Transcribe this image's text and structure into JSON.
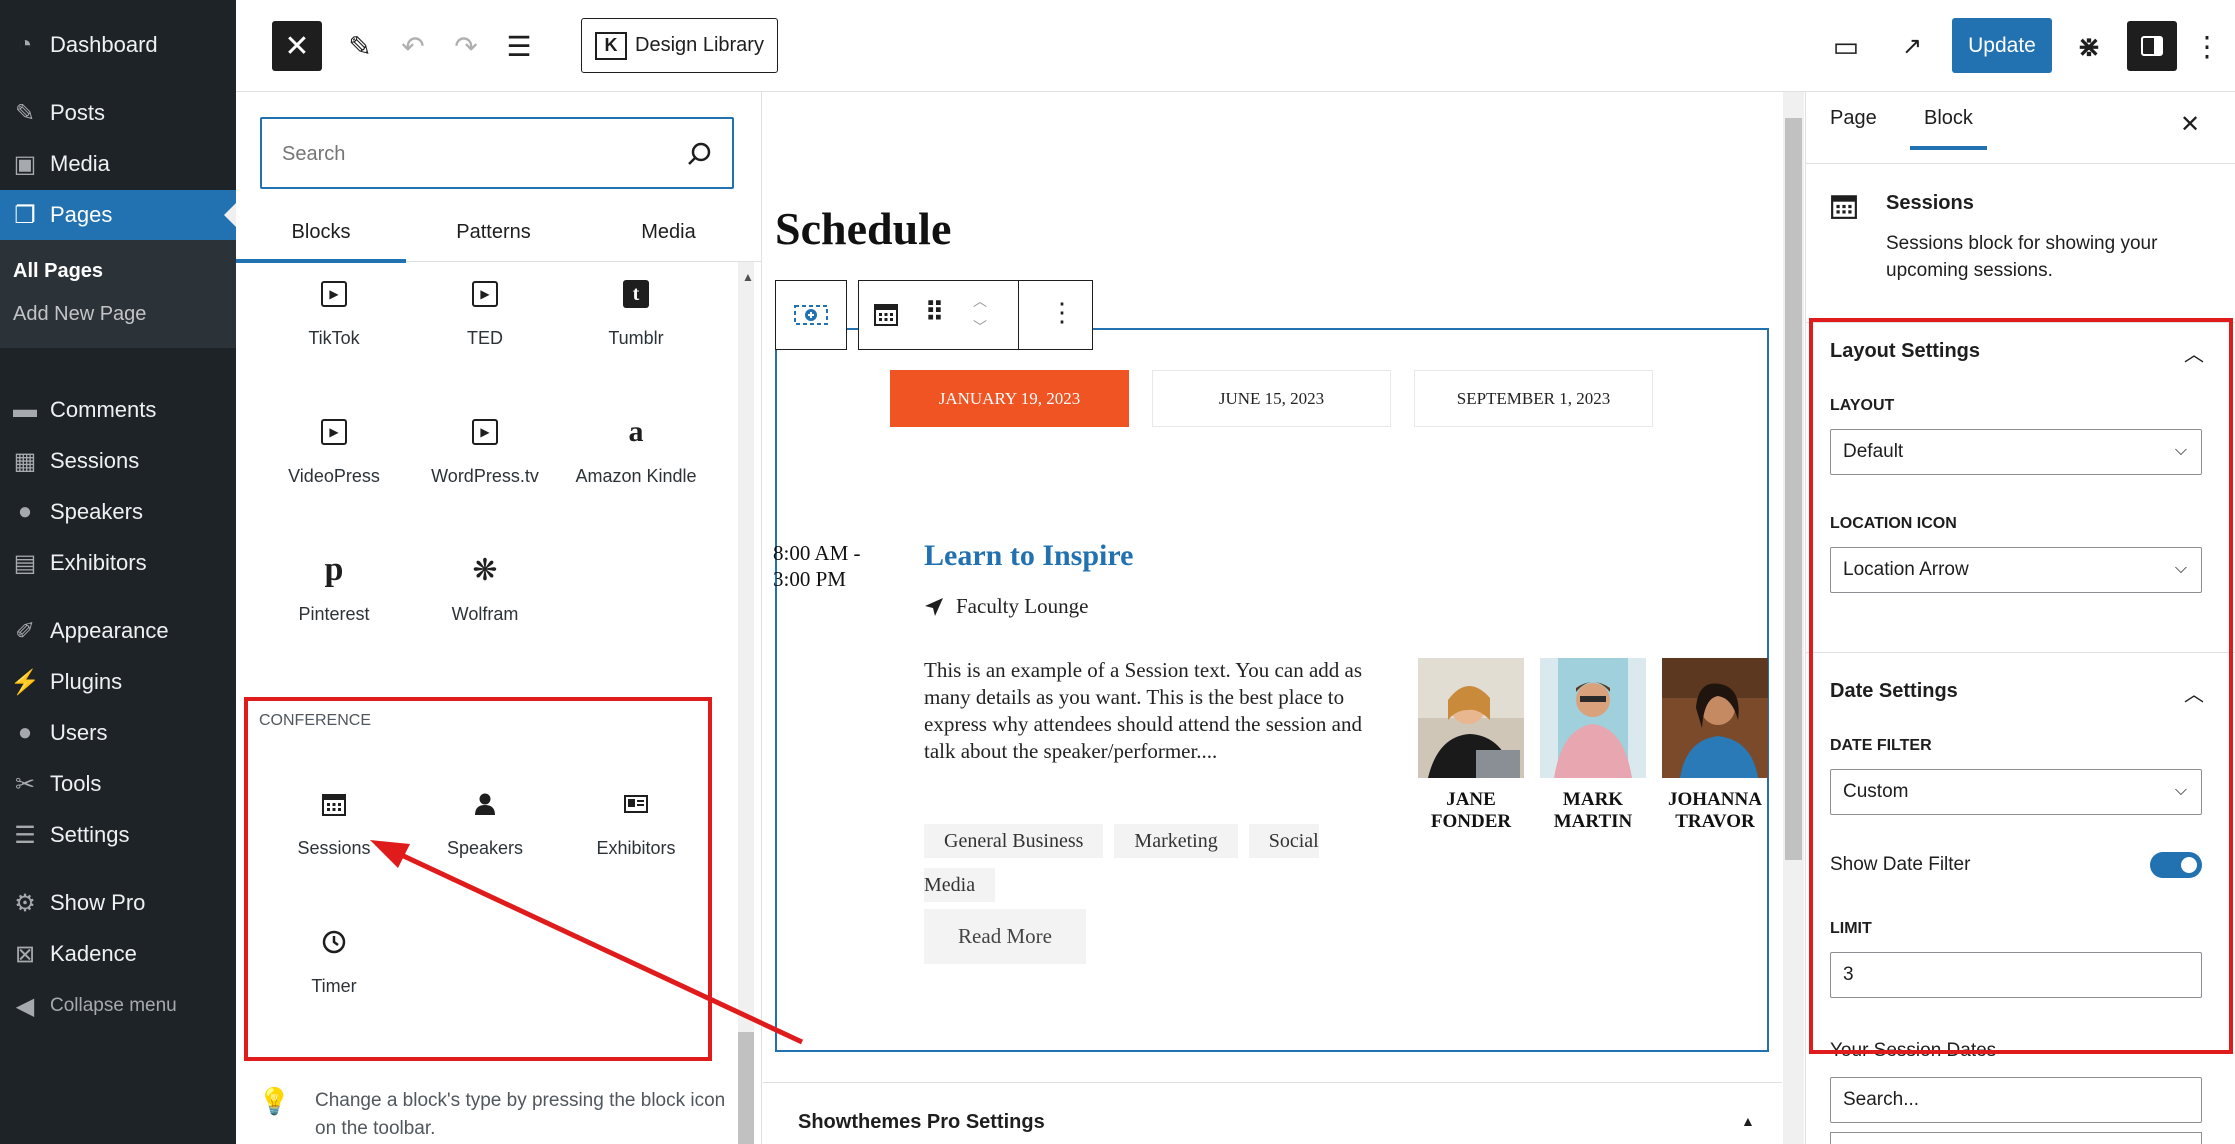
{
  "admin_menu": {
    "items": [
      {
        "label": "Dashboard",
        "icon": "dashboard-icon"
      },
      {
        "label": "Posts",
        "icon": "pin-icon"
      },
      {
        "label": "Media",
        "icon": "media-icon"
      },
      {
        "label": "Pages",
        "icon": "pages-icon"
      },
      {
        "label": "Comments",
        "icon": "comment-icon"
      },
      {
        "label": "Sessions",
        "icon": "calendar-icon"
      },
      {
        "label": "Speakers",
        "icon": "person-icon"
      },
      {
        "label": "Exhibitors",
        "icon": "id-card-icon"
      },
      {
        "label": "Appearance",
        "icon": "brush-icon"
      },
      {
        "label": "Plugins",
        "icon": "plug-icon"
      },
      {
        "label": "Users",
        "icon": "users-icon"
      },
      {
        "label": "Tools",
        "icon": "wrench-icon"
      },
      {
        "label": "Settings",
        "icon": "sliders-icon"
      },
      {
        "label": "Show Pro",
        "icon": "gear-icon"
      },
      {
        "label": "Kadence",
        "icon": "kadence-icon"
      }
    ],
    "submenu": [
      "All Pages",
      "Add New Page"
    ],
    "collapse_label": "Collapse menu"
  },
  "toolbar": {
    "design_library_label": "Design Library",
    "update_label": "Update"
  },
  "inserter": {
    "search_placeholder": "Search",
    "tabs": [
      "Blocks",
      "Patterns",
      "Media"
    ],
    "embed_blocks": [
      {
        "label": "TikTok",
        "icon": "tiktok-icon"
      },
      {
        "label": "TED",
        "icon": "ted-icon"
      },
      {
        "label": "Tumblr",
        "icon": "tumblr-icon"
      },
      {
        "label": "VideoPress",
        "icon": "videopress-icon"
      },
      {
        "label": "WordPress.tv",
        "icon": "wordpresstv-icon"
      },
      {
        "label": "Amazon Kindle",
        "icon": "amazon-icon"
      },
      {
        "label": "Pinterest",
        "icon": "pinterest-icon"
      },
      {
        "label": "Wolfram",
        "icon": "wolfram-icon"
      }
    ],
    "category_label": "CONFERENCE",
    "conference_blocks": [
      {
        "label": "Sessions",
        "icon": "calendar-icon"
      },
      {
        "label": "Speakers",
        "icon": "person-icon"
      },
      {
        "label": "Exhibitors",
        "icon": "id-card-icon"
      },
      {
        "label": "Timer",
        "icon": "clock-icon"
      }
    ],
    "tip": "Change a block's type by pressing the block icon on the toolbar."
  },
  "canvas": {
    "page_title": "Schedule",
    "date_tabs": [
      "JANUARY 19, 2023",
      "JUNE 15, 2023",
      "SEPTEMBER 1, 2023"
    ],
    "session": {
      "time_line1": "8:00 AM -",
      "time_line2": "3:00 PM",
      "title": "Learn to Inspire",
      "location": "Faculty Lounge",
      "description": "This is an example of a Session text. You can add as many details as you want. This is the best place to express why attendees should attend the session and talk about the speaker/performer....",
      "tags": [
        "General Business",
        "Marketing",
        "Social Media"
      ],
      "read_more": "Read More",
      "speakers": [
        {
          "line1": "JANE",
          "line2": "FONDER"
        },
        {
          "line1": "MARK",
          "line2": "MARTIN"
        },
        {
          "line1": "JOHANNA",
          "line2": "TRAVOR"
        }
      ]
    },
    "metabox_title": "Showthemes Pro Settings"
  },
  "settings": {
    "tabs": [
      "Page",
      "Block"
    ],
    "block_card": {
      "title": "Sessions",
      "description": "Sessions block for showing your upcoming sessions."
    },
    "layout_panel": {
      "title": "Layout Settings",
      "layout_label": "LAYOUT",
      "layout_value": "Default",
      "location_icon_label": "LOCATION ICON",
      "location_icon_value": "Location Arrow"
    },
    "date_panel": {
      "title": "Date Settings",
      "date_filter_label": "DATE FILTER",
      "date_filter_value": "Custom",
      "show_date_filter_label": "Show Date Filter",
      "show_date_filter_on": true,
      "limit_label": "LIMIT",
      "limit_value": "3",
      "session_dates_label": "Your Session Dates",
      "session_dates_placeholder": "Search..."
    }
  },
  "colors": {
    "wp_blue": "#2271b1",
    "admin_bg": "#1d2327",
    "date_active": "#f05423",
    "annotation_red": "#e01b1b"
  }
}
